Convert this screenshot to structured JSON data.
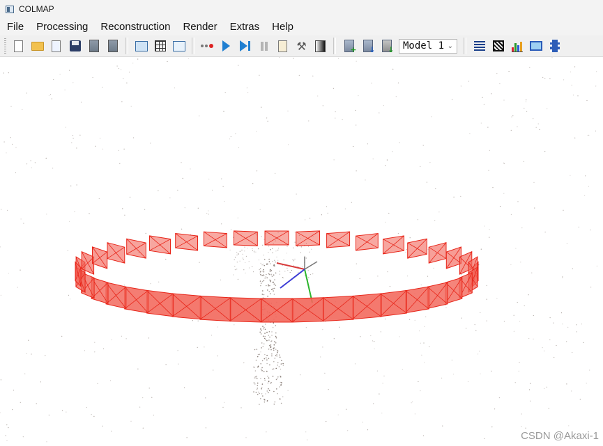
{
  "window": {
    "title": "COLMAP",
    "icon": "colmap-app-icon"
  },
  "menu": [
    "File",
    "Processing",
    "Reconstruction",
    "Render",
    "Extras",
    "Help"
  ],
  "toolbar": {
    "groups": [
      [
        "new-project-icon",
        "open-project-icon",
        "edit-project-icon",
        "save-project-icon",
        "import-model-icon",
        "export-model-icon"
      ],
      [
        "feature-extraction-icon",
        "feature-matching-icon",
        "database-management-icon"
      ],
      [
        "automatic-reconstruction-icon",
        "start-reconstruction-icon",
        "step-reconstruction-icon",
        "pause-reconstruction-icon",
        "reconstruction-options-icon",
        "bundle-adjustment-icon",
        "render-options-icon"
      ],
      [
        "import-database-icon",
        "export-database-icon",
        "download-model-icon"
      ],
      [
        "show-log-icon",
        "grab-image-icon",
        "reconstruction-stats-icon",
        "grab-movie-icon",
        "video-icon"
      ]
    ],
    "model_selector": {
      "value": "Model 1",
      "chevron": "chevron-down-icon"
    }
  },
  "viewport": {
    "content": "sparse point cloud with circular camera trajectory",
    "camera_frustum_color": "#e8261a",
    "frustum_fill": "#f2665a",
    "point_color": "#6b5d55",
    "axes": {
      "x": "#d83a3a",
      "y": "#2db52d",
      "z": "#3b3bd6"
    }
  },
  "watermark": "CSDN @Akaxi-1"
}
